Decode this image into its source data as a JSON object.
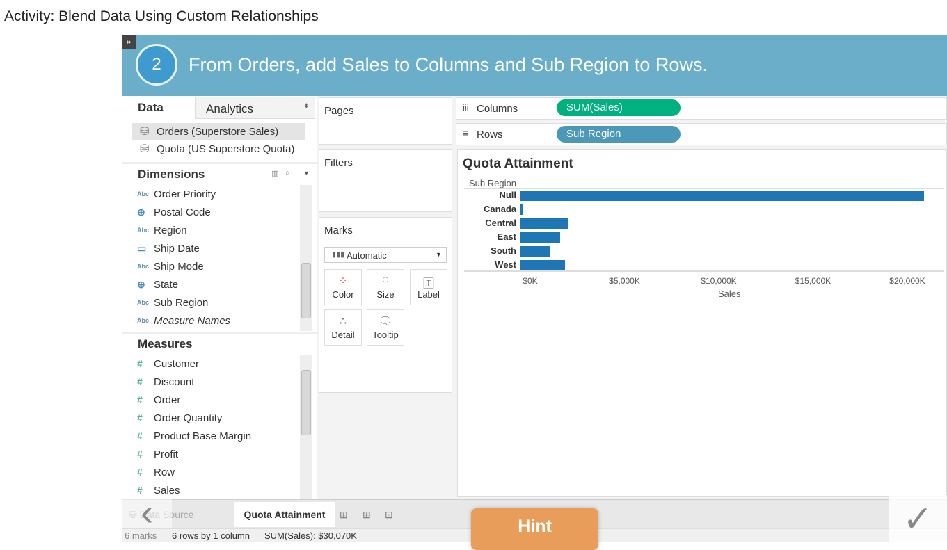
{
  "activity_title": "Activity: Blend Data Using Custom Relationships",
  "step": {
    "number": "2",
    "instruction": "From Orders, add Sales to Columns and Sub Region to Rows."
  },
  "data_pane": {
    "tabs": [
      "Data",
      "Analytics"
    ],
    "sources": [
      "Orders (Superstore Sales)",
      "Quota (US Superstore Quota)"
    ],
    "dimensions_label": "Dimensions",
    "dimensions": [
      {
        "icon": "abc",
        "label": "Order Priority"
      },
      {
        "icon": "globe",
        "label": "Postal Code"
      },
      {
        "icon": "abc",
        "label": "Region"
      },
      {
        "icon": "calendar",
        "label": "Ship Date"
      },
      {
        "icon": "abc",
        "label": "Ship Mode"
      },
      {
        "icon": "globe",
        "label": "State"
      },
      {
        "icon": "abc",
        "label": "Sub Region"
      },
      {
        "icon": "abc",
        "label": "Measure Names"
      }
    ],
    "measures_label": "Measures",
    "measures": [
      "Customer",
      "Discount",
      "Order",
      "Order Quantity",
      "Product Base Margin",
      "Profit",
      "Row",
      "Sales"
    ],
    "abc_glyph": "Abc",
    "hash_glyph": "#"
  },
  "cards": {
    "pages": "Pages",
    "filters": "Filters",
    "marks": "Marks",
    "mark_type": "Automatic",
    "mark_buttons": [
      "Color",
      "Size",
      "Label",
      "Detail",
      "Tooltip"
    ]
  },
  "shelves": {
    "columns_label": "Columns",
    "rows_label": "Rows",
    "columns_pill": "SUM(Sales)",
    "rows_pill": "Sub Region",
    "columns_color": "#00b180",
    "rows_color": "#4b98b8"
  },
  "chart_data": {
    "type": "bar",
    "title": "Quota Attainment",
    "orientation": "horizontal",
    "ylabel": "Sub Region",
    "xlabel": "Sales",
    "categories": [
      "Null",
      "Canada",
      "Central",
      "East",
      "South",
      "West"
    ],
    "values": [
      21400,
      150,
      2500,
      2100,
      1570,
      2350
    ],
    "unit": "$K",
    "xlim": [
      0,
      22000
    ],
    "ticks": [
      0,
      5000,
      10000,
      15000,
      20000
    ],
    "tick_labels": [
      "$0K",
      "$5,000K",
      "$10,000K",
      "$15,000K",
      "$20,000K"
    ],
    "color": "#1f76b4",
    "grid": false
  },
  "tabs": {
    "data_source": "Data Source",
    "sheet": "Quota Attainment"
  },
  "status": {
    "marks": "6 marks",
    "rows": "6 rows by 1 column",
    "sum": "SUM(Sales): $30,070K"
  },
  "hint": "Hint"
}
